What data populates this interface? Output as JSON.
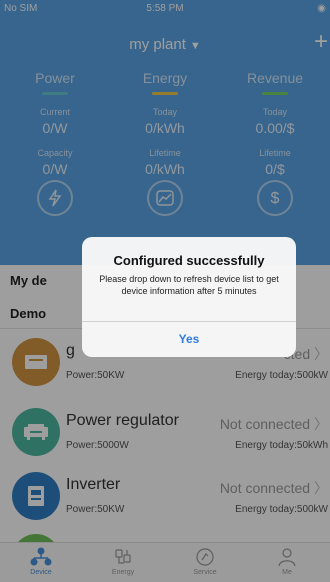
{
  "status_bar": {
    "carrier": "No SIM",
    "time": "5:58 PM",
    "battery": "◉"
  },
  "nav": {
    "title": "my plant",
    "chevron": "▼",
    "plus": "+"
  },
  "columns": [
    {
      "head": "Power",
      "bar_color": "#67c8d2",
      "label1": "Current",
      "value1": "0/W",
      "label2": "Capacity",
      "value2": "0/W"
    },
    {
      "head": "Energy",
      "bar_color": "#f2c94c",
      "label1": "Today",
      "value1": "0/kWh",
      "label2": "Lifetime",
      "value2": "0/kWh"
    },
    {
      "head": "Revenue",
      "bar_color": "#7ad36b",
      "label1": "Today",
      "value1": "0.00/$",
      "label2": "Lifetime",
      "value2": "0/$"
    }
  ],
  "quick_icons": [
    "lightning-icon",
    "chart-icon",
    "dollar-icon"
  ],
  "section": {
    "title": "My de",
    "subtitle": "Demo"
  },
  "devices": [
    {
      "name": "g",
      "power": "Power:50KW",
      "status": "cted",
      "energy": "Energy today:500kW",
      "icon_color": "#d29542",
      "icon": "inverter-icon"
    },
    {
      "name": "Power regulator",
      "power": "Power:5000W",
      "status": "Not connected",
      "energy": "Energy today:50kWh",
      "icon_color": "#4cb8a0",
      "icon": "regulator-icon"
    },
    {
      "name": "Inverter",
      "power": "Power:50KW",
      "status": "Not connected",
      "energy": "Energy today:500kW",
      "icon_color": "#2f7fc6",
      "icon": "inverter-icon"
    }
  ],
  "tabs": [
    {
      "label": "Device",
      "icon": "device-tree-icon",
      "active": true
    },
    {
      "label": "Energy",
      "icon": "energy-icon",
      "active": false
    },
    {
      "label": "Service",
      "icon": "service-icon",
      "active": false
    },
    {
      "label": "Me",
      "icon": "person-icon",
      "active": false
    }
  ],
  "dialog": {
    "title": "Configured successfully",
    "message": "Please drop down  to refresh device list to get device information after 5 minutes",
    "button": "Yes"
  },
  "colors": {
    "header": "#5aa4e4",
    "accent": "#2f7de1"
  }
}
